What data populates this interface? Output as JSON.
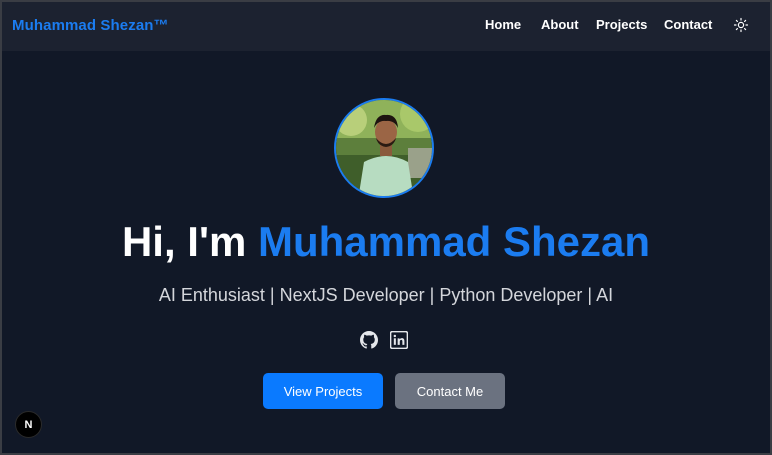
{
  "navbar": {
    "brand": "Muhammad Shezan™",
    "links": [
      "Home",
      "About",
      "Projects",
      "Contact"
    ],
    "theme_icon": "sun-icon"
  },
  "hero": {
    "greeting": "Hi, I'm",
    "name": "Muhammad Shezan",
    "subtitle": "AI Enthusiast | NextJS Developer | Python Developer | AI",
    "social_icons": [
      "github-icon",
      "linkedin-icon"
    ],
    "primary_button": "View Projects",
    "secondary_button": "Contact Me"
  },
  "dev_badge": "N",
  "colors": {
    "background": "#111827",
    "navbar": "#1c2230",
    "accent": "#1b7cf0",
    "primary_button": "#0a7aff",
    "secondary_button": "#6b7280"
  }
}
